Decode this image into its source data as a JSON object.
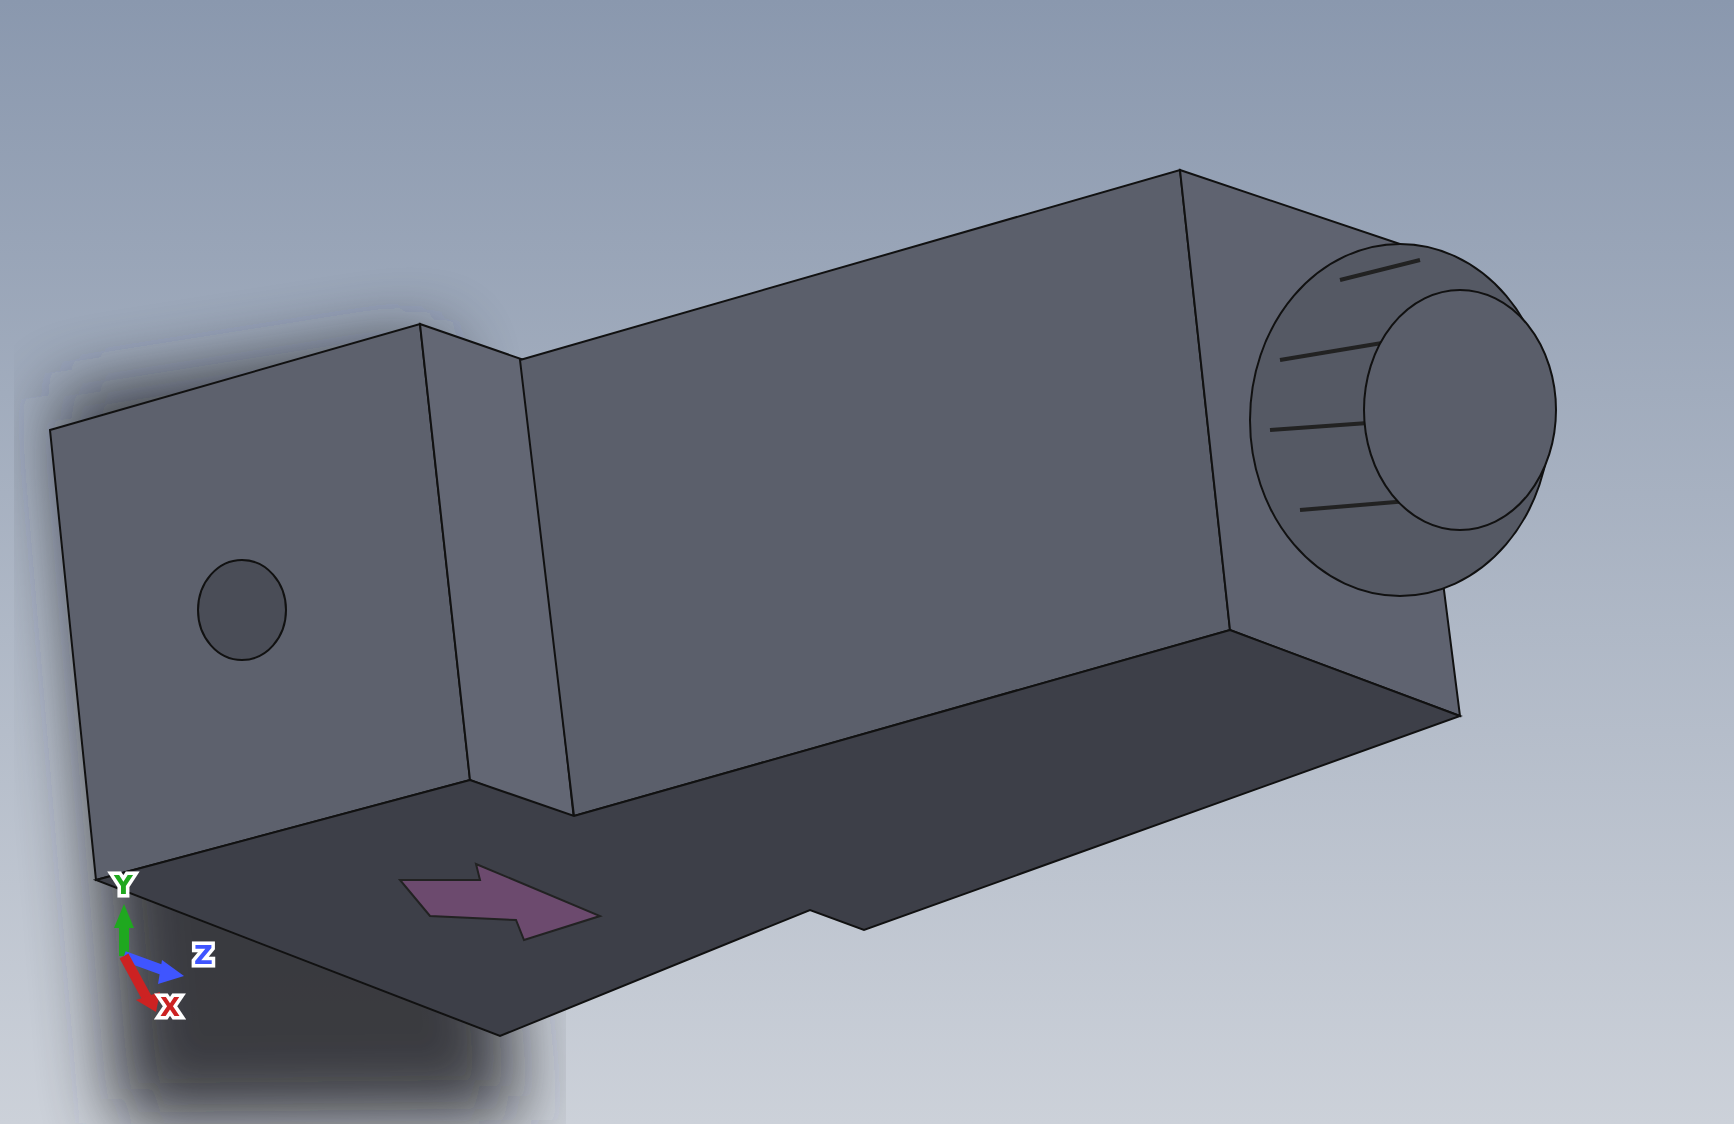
{
  "viewport": {
    "triad": {
      "axes": [
        {
          "label": "Y",
          "color": "#1fa81f"
        },
        {
          "label": "Z",
          "color": "#3f55ff"
        },
        {
          "label": "X",
          "color": "#cc2222"
        }
      ]
    }
  }
}
